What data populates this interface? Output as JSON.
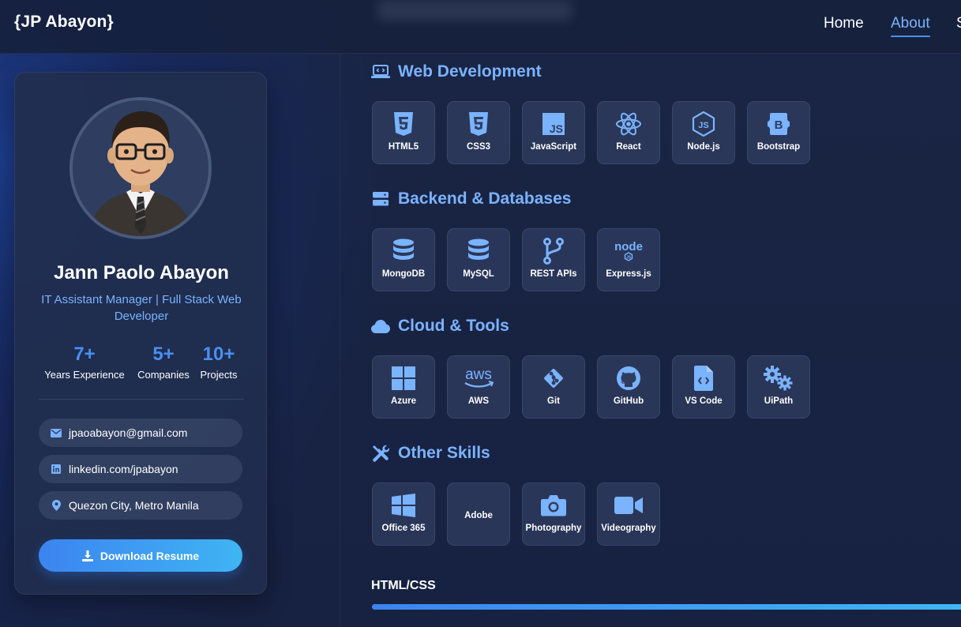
{
  "navbar": {
    "brand": "{JP Abayon}",
    "links": [
      {
        "label": "Home",
        "active": false
      },
      {
        "label": "About",
        "active": true
      },
      {
        "label": "S",
        "active": false
      }
    ]
  },
  "profile": {
    "name": "Jann Paolo Abayon",
    "role": "IT Assistant Manager | Full Stack Web Developer",
    "stats": [
      {
        "value": "7+",
        "label": "Years Experience"
      },
      {
        "value": "5+",
        "label": "Companies"
      },
      {
        "value": "10+",
        "label": "Projects"
      }
    ],
    "contacts": {
      "email": "jpaoabayon@gmail.com",
      "linkedin": "linkedin.com/jpabayon",
      "location": "Quezon City, Metro Manila"
    },
    "download_label": "Download Resume"
  },
  "skills": {
    "web": {
      "title": "Web Development",
      "icon": "laptop-code-icon",
      "items": [
        {
          "label": "HTML5",
          "icon": "html5-icon"
        },
        {
          "label": "CSS3",
          "icon": "css3-icon"
        },
        {
          "label": "JavaScript",
          "icon": "javascript-icon"
        },
        {
          "label": "React",
          "icon": "react-icon"
        },
        {
          "label": "Node.js",
          "icon": "nodejs-icon"
        },
        {
          "label": "Bootstrap",
          "icon": "bootstrap-icon"
        }
      ]
    },
    "backend": {
      "title": "Backend & Databases",
      "icon": "server-icon",
      "items": [
        {
          "label": "MongoDB",
          "icon": "database-icon"
        },
        {
          "label": "MySQL",
          "icon": "database-icon"
        },
        {
          "label": "REST APIs",
          "icon": "code-branch-icon"
        },
        {
          "label": "Express.js",
          "icon": "node-logo-icon"
        }
      ]
    },
    "cloud": {
      "title": "Cloud & Tools",
      "icon": "cloud-icon",
      "items": [
        {
          "label": "Azure",
          "icon": "windows-icon"
        },
        {
          "label": "AWS",
          "icon": "aws-icon"
        },
        {
          "label": "Git",
          "icon": "git-icon"
        },
        {
          "label": "GitHub",
          "icon": "github-icon"
        },
        {
          "label": "VS Code",
          "icon": "file-code-icon"
        },
        {
          "label": "UiPath",
          "icon": "gears-icon"
        }
      ]
    },
    "other": {
      "title": "Other Skills",
      "icon": "tools-icon",
      "items": [
        {
          "label": "Office 365",
          "icon": "windows-icon"
        },
        {
          "label": "Adobe",
          "icon": ""
        },
        {
          "label": "Photography",
          "icon": "camera-icon"
        },
        {
          "label": "Videography",
          "icon": "video-icon"
        }
      ]
    }
  },
  "progress": {
    "label": "HTML/CSS",
    "percent": 100
  },
  "colors": {
    "accent": "#7ab3ff",
    "accent_strong": "#4a8ff0",
    "background": "#16213f",
    "card": "#212e4e"
  }
}
